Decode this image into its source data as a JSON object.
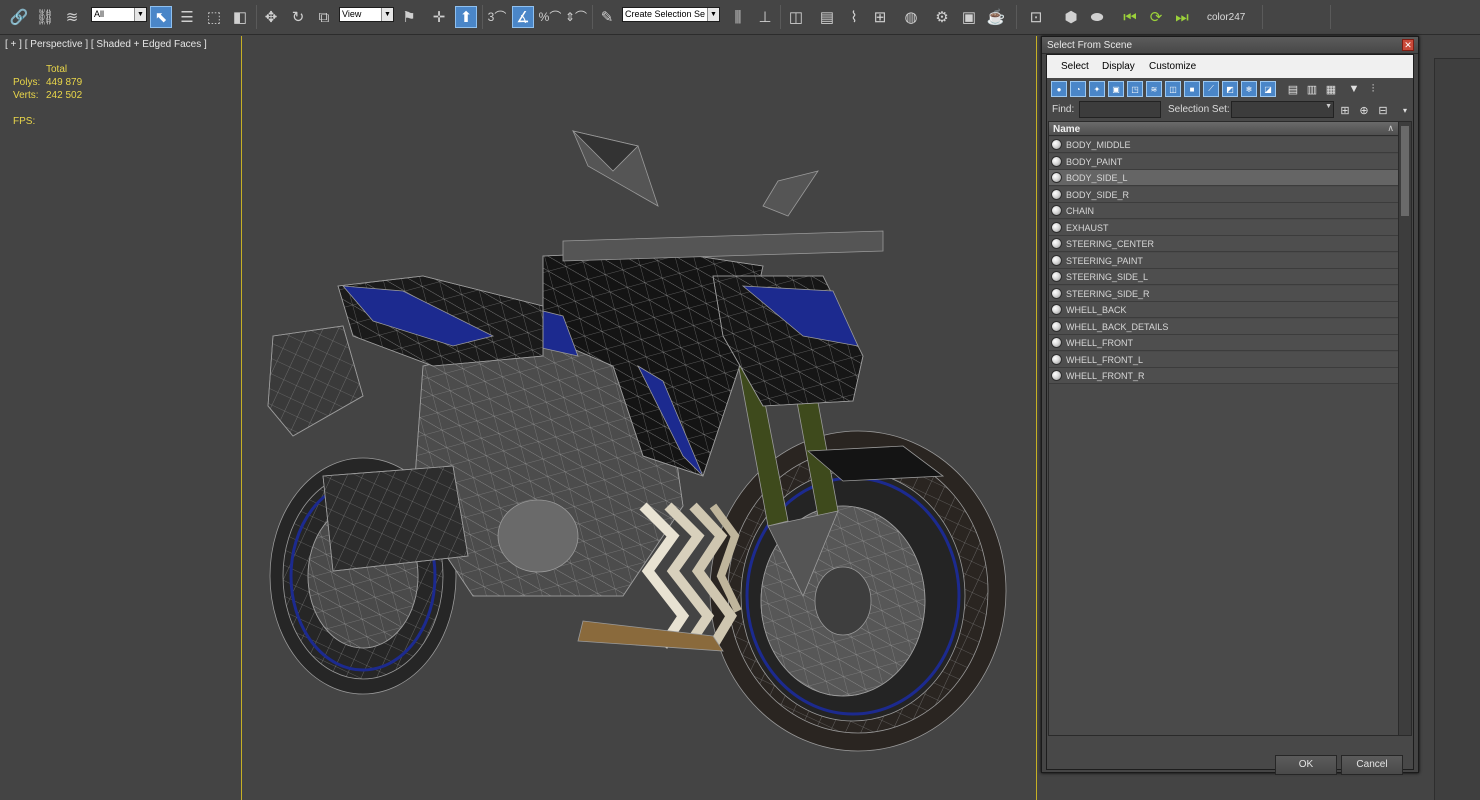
{
  "toolbar": {
    "filter_dropdown": "All",
    "ref_coord_dropdown": "View",
    "selection_set_dropdown": "Create Selection Se",
    "color_label": "color247",
    "icons": [
      "link-icon",
      "unlink-icon",
      "bind-spacewarp-icon",
      "select-object-icon",
      "select-by-name-icon",
      "rectangular-selection-icon",
      "window-crossing-icon",
      "move-icon",
      "rotate-icon",
      "scale-icon",
      "pivot-icon",
      "keyboard-shortcut-icon",
      "manipulate-icon",
      "snap-3d-icon",
      "angle-snap-icon",
      "percent-snap-icon",
      "spinner-snap-icon",
      "named-selection-icon",
      "mirror-icon",
      "align-icon",
      "layer-manager-icon",
      "scene-explorer-icon",
      "curve-editor-icon",
      "schematic-view-icon",
      "material-editor-icon",
      "render-setup-icon",
      "render-frame-icon",
      "render-icon",
      "teapot-icon"
    ]
  },
  "viewport": {
    "label": "[ + ] [ Perspective ] [ Shaded + Edged Faces ]",
    "stats": {
      "total_label": "Total",
      "polys_label": "Polys:",
      "polys_value": "449 879",
      "verts_label": "Verts:",
      "verts_value": "242 502",
      "fps_label": "FPS:"
    }
  },
  "dialog": {
    "title": "Select From Scene",
    "menus": [
      "Select",
      "Display",
      "Customize"
    ],
    "find_label": "Find:",
    "find_value": "",
    "selection_set_label": "Selection Set:",
    "selection_set_value": "",
    "column_header": "Name",
    "items": [
      {
        "label": "BODY_MIDDLE",
        "selected": false
      },
      {
        "label": "BODY_PAINT",
        "selected": false
      },
      {
        "label": "BODY_SIDE_L",
        "selected": true
      },
      {
        "label": "BODY_SIDE_R",
        "selected": false
      },
      {
        "label": "CHAIN",
        "selected": false
      },
      {
        "label": "EXHAUST",
        "selected": false
      },
      {
        "label": "STEERING_CENTER",
        "selected": false
      },
      {
        "label": "STEERING_PAINT",
        "selected": false
      },
      {
        "label": "STEERING_SIDE_L",
        "selected": false
      },
      {
        "label": "STEERING_SIDE_R",
        "selected": false
      },
      {
        "label": "WHELL_BACK",
        "selected": false
      },
      {
        "label": "WHELL_BACK_DETAILS",
        "selected": false
      },
      {
        "label": "WHELL_FRONT",
        "selected": false
      },
      {
        "label": "WHELL_FRONT_L",
        "selected": false
      },
      {
        "label": "WHELL_FRONT_R",
        "selected": false
      }
    ],
    "ok_label": "OK",
    "cancel_label": "Cancel"
  },
  "colors": {
    "viewport_border": "#c6b025",
    "stats_text": "#e9d64a",
    "active_tool": "#4a86c8",
    "bike_accent": "#1c2a8f"
  }
}
